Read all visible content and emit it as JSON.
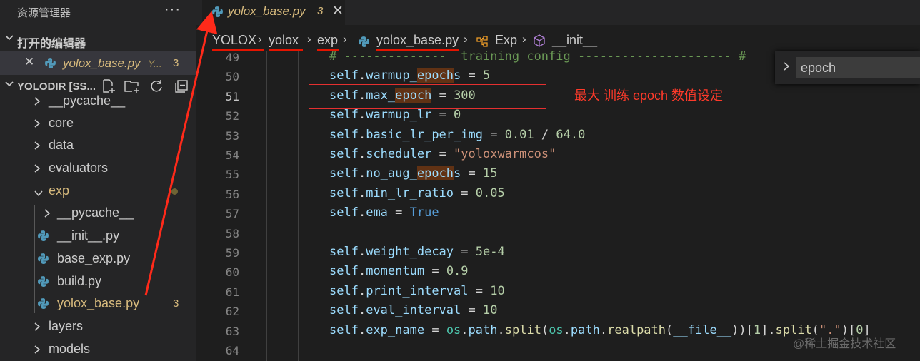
{
  "sidebar": {
    "title": "资源管理器",
    "more_label": "···",
    "open_editors_label": "打开的编辑器",
    "open_editor": {
      "name": "yolox_base.py",
      "hint": "Y...",
      "count": "3"
    },
    "project_label": "YOLODIR [SS...",
    "tree": [
      {
        "label": "__pycache__",
        "kind": "folder"
      },
      {
        "label": "core",
        "kind": "folder"
      },
      {
        "label": "data",
        "kind": "folder"
      },
      {
        "label": "evaluators",
        "kind": "folder"
      },
      {
        "label": "exp",
        "kind": "folder-open"
      },
      {
        "label": "__pycache__",
        "kind": "folder"
      },
      {
        "label": "__init__.py",
        "kind": "file"
      },
      {
        "label": "base_exp.py",
        "kind": "file"
      },
      {
        "label": "build.py",
        "kind": "file"
      },
      {
        "label": "yolox_base.py",
        "kind": "file",
        "badge": "3"
      },
      {
        "label": "layers",
        "kind": "folder"
      },
      {
        "label": "models",
        "kind": "folder"
      }
    ]
  },
  "tab": {
    "name": "yolox_base.py",
    "count": "3",
    "close": "✕"
  },
  "breadcrumb": [
    "YOLOX",
    "yolox",
    "exp",
    "yolox_base.py",
    "Exp",
    "__init__"
  ],
  "find": {
    "value": "epoch"
  },
  "code": {
    "lines": [
      {
        "num": "49",
        "text": "# --------------  training config --------------------- #"
      },
      {
        "num": "50",
        "text": "self.warmup_epochs = 5"
      },
      {
        "num": "51",
        "text": "self.max_epoch = 300"
      },
      {
        "num": "52",
        "text": "self.warmup_lr = 0"
      },
      {
        "num": "53",
        "text": "self.basic_lr_per_img = 0.01 / 64.0"
      },
      {
        "num": "54",
        "text": "self.scheduler = \"yoloxwarmcos\""
      },
      {
        "num": "55",
        "text": "self.no_aug_epochs = 15"
      },
      {
        "num": "56",
        "text": "self.min_lr_ratio = 0.05"
      },
      {
        "num": "57",
        "text": "self.ema = True"
      },
      {
        "num": "58",
        "text": ""
      },
      {
        "num": "59",
        "text": "self.weight_decay = 5e-4"
      },
      {
        "num": "60",
        "text": "self.momentum = 0.9"
      },
      {
        "num": "61",
        "text": "self.print_interval = 10"
      },
      {
        "num": "62",
        "text": "self.eval_interval = 10"
      },
      {
        "num": "63",
        "text": "self.exp_name = os.path.split(os.path.realpath(__file__))[1].split(\".\")[0]"
      },
      {
        "num": "64",
        "text": ""
      }
    ]
  },
  "annotation": "最大 训练 epoch 数值设定",
  "watermark": "@稀土掘金技术社区",
  "colors": {
    "accent_modified": "#d7ba7d",
    "annotation_red": "#e51400",
    "find_highlight": "#613214"
  }
}
